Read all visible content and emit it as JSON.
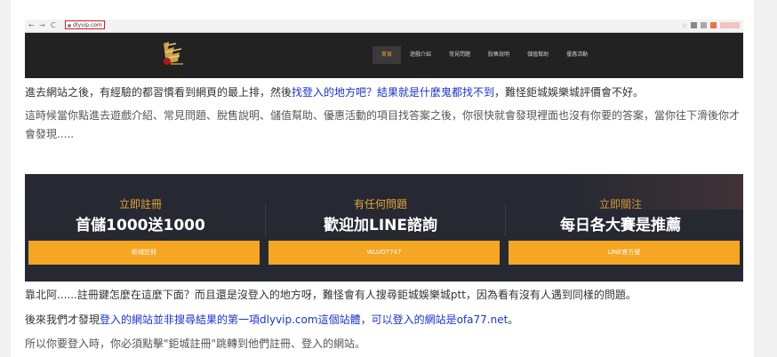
{
  "browser": {
    "back": "←",
    "forward": "→",
    "reload": "C",
    "url": "dlyvip.com"
  },
  "site_nav": {
    "items": [
      "首頁",
      "遊戲介紹",
      "常見問題",
      "脫售說明",
      "儲值幫助",
      "優惠活動"
    ]
  },
  "para1": {
    "a": "進去網站之後，有經驗的都習慣看到網頁的最上排，然後",
    "link": "找登入的地方吧？結果就是什麼鬼都找不到",
    "b": "，難怪鉅城娛樂城評價會不好。"
  },
  "para2": "這時候當你點進去遊戲介紹、常見問題、脫售說明、儲值幫助、優惠活動的項目找答案之後，你很快就會發現裡面也沒有你要的答案，當你往下滑後你才會發現.....",
  "banner": {
    "columns": [
      {
        "top": "立即註冊",
        "main": "首儲1000送1000",
        "button": "鉅城註冊"
      },
      {
        "top": "有任何問題",
        "main": "歡迎加LINE諮詢",
        "button": "WLUO7747"
      },
      {
        "top": "立即關注",
        "main": "每日各大賽是推薦",
        "button": "LINE官方號"
      }
    ]
  },
  "para3": "靠北阿......註冊鍵怎麼在這麼下面？而且還是沒登入的地方呀，難怪會有人搜尋鉅城娛樂城ptt，因為看有沒有人遇到同樣的問題。",
  "para4": {
    "a": "後來我們才發現",
    "link1": "登入的網站並非搜尋結果的第一項dlyvip.com這個站體",
    "b": "，",
    "link2": "可以登入的網站是ofa77.net",
    "c": "。"
  },
  "para5": "所以你要登入時，你必須點擊\"鉅城註冊\"跳轉到他們註冊、登入的網站。",
  "colors": {
    "link": "#1a33d6",
    "accent_orange": "#f5a623",
    "banner_bg": "#262932",
    "url_highlight": "#d3201f"
  }
}
